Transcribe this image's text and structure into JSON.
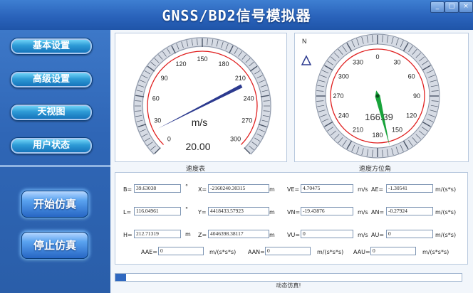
{
  "window": {
    "title": "GNSS/BD2信号模拟器",
    "controls": [
      "_",
      "□",
      "×"
    ]
  },
  "sidebar": {
    "menu": [
      {
        "label": "基本设置"
      },
      {
        "label": "高级设置"
      },
      {
        "label": "天视图"
      },
      {
        "label": "用户状态"
      }
    ],
    "start_label": "开始仿真",
    "stop_label": "停止仿真"
  },
  "speed_gauge": {
    "caption": "速度表",
    "unit": "m/s",
    "readout": "20.00",
    "value": 20.0,
    "min": 0,
    "max": 300,
    "ticks": [
      "0",
      "30",
      "60",
      "90",
      "120",
      "150",
      "180",
      "210",
      "240",
      "270",
      "300"
    ]
  },
  "heading_gauge": {
    "caption": "速度方位角",
    "north_label": "N",
    "readout": "166.39",
    "value": 166.39,
    "ticks": [
      "0",
      "30",
      "60",
      "90",
      "120",
      "150",
      "180",
      "210",
      "240",
      "270",
      "300",
      "330"
    ]
  },
  "fields": {
    "B": {
      "label": "B=",
      "value": "39.63038",
      "unit": "°"
    },
    "L": {
      "label": "L=",
      "value": "116.04961",
      "unit": "°"
    },
    "H": {
      "label": "H=",
      "value": "212.71319",
      "unit": "m"
    },
    "X": {
      "label": "X=",
      "value": "-2160240.30315",
      "unit": "m"
    },
    "Y": {
      "label": "Y=",
      "value": "4418433.57923",
      "unit": "m"
    },
    "Z": {
      "label": "Z=",
      "value": "4046398.38117",
      "unit": "m"
    },
    "VE": {
      "label": "VE=",
      "value": "4.70475",
      "unit": "m/s"
    },
    "VN": {
      "label": "VN=",
      "value": "-19.43876",
      "unit": "m/s"
    },
    "VU": {
      "label": "VU=",
      "value": "0",
      "unit": "m/s"
    },
    "AE": {
      "label": "AE=",
      "value": "-1.30541",
      "unit": "m/(s*s)"
    },
    "AN": {
      "label": "AN=",
      "value": "-0.27924",
      "unit": "m/(s*s)"
    },
    "AU": {
      "label": "AU=",
      "value": "0",
      "unit": "m/(s*s)"
    },
    "AAE": {
      "label": "AAE=",
      "value": "0",
      "unit": "m/(s*s*s)"
    },
    "AAN": {
      "label": "AAN=",
      "value": "0",
      "unit": "m/(s*s*s)"
    },
    "AAU": {
      "label": "AAU=",
      "value": "0",
      "unit": "m/(s*s*s)"
    }
  },
  "progress": {
    "value": 0.03,
    "status": "动态仿真!"
  },
  "colors": {
    "accent_blue": "#2a63bb",
    "needle_speed": "#2c3a8f",
    "needle_heading": "#18a33a",
    "red_arc": "#e02020"
  }
}
